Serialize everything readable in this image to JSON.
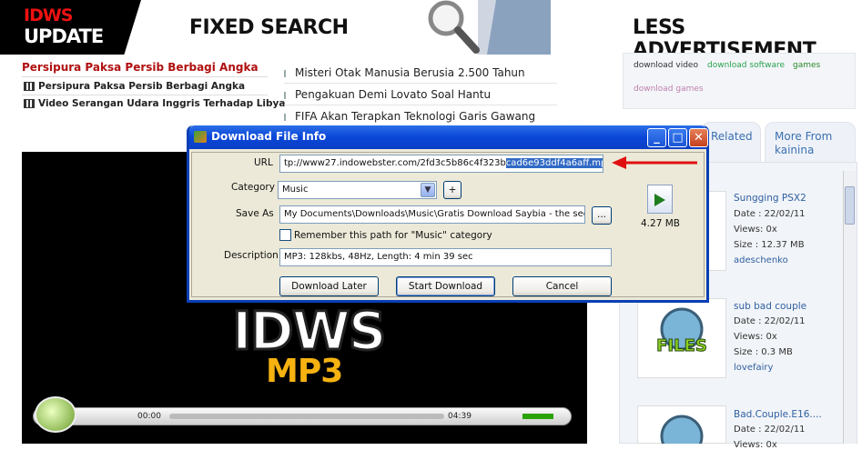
{
  "banner": {
    "logo_top": "IDWS",
    "logo_bottom": "UPDATE",
    "fixed_search": "FIXED SEARCH",
    "less_ad": "LESS ADVERTISEMENT"
  },
  "featured": {
    "title": "Persipura Paksa Persib Berbagi Angka",
    "items": [
      "Persipura Paksa Persib Berbagi Angka",
      "Video Serangan Udara Inggris Terhadap Libya"
    ]
  },
  "news": [
    "Misteri Otak Manusia Berusia 2.500 Tahun",
    "Pengakuan Demi Lovato Soal Hantu",
    "FIFA Akan Terapkan Teknologi Garis Gawang"
  ],
  "tags": {
    "t1": "download video",
    "t2": "download software",
    "t3": "games",
    "t4": "download games"
  },
  "tabs": {
    "related": "Related",
    "more_from_1": "More From",
    "more_from_2": "kainina"
  },
  "player": {
    "logo": "IDWS",
    "sub": "MP3",
    "time_elapsed": "00:00",
    "time_total": "04:39"
  },
  "sidebar_items": [
    {
      "title": "Sungging PSX2",
      "date": "Date : 22/02/11",
      "views": "Views: 0x",
      "size": "Size : 12.37 MB",
      "user": "adeschenko"
    },
    {
      "title": "sub bad couple",
      "date": "Date : 22/02/11",
      "views": "Views: 0x",
      "size": "Size : 0.3 MB",
      "user": "lovefairy"
    },
    {
      "title": "Bad.Couple.E16....",
      "date": "Date : 22/02/11",
      "views": "Views: 0x"
    }
  ],
  "dialog": {
    "title": "Download File Info",
    "url_label": "URL",
    "url_plain": "tp://www27.indowebster.com/2fd3c5b86c4f323b",
    "url_selected": "cad6e93ddf4a6aff.mp3",
    "category_label": "Category",
    "category_value": "Music",
    "plus": "+",
    "saveas_label": "Save As",
    "saveas_value": "My Documents\\Downloads\\Music\\Gratis Download Saybia - the secor",
    "browse": "...",
    "remember": "Remember this path for \"Music\" category",
    "description_label": "Description",
    "description_value": "MP3: 128kbs, 48Hz, Length: 4 min 39 sec",
    "file_size": "4.27  MB",
    "btn_later": "Download Later",
    "btn_start": "Start Download",
    "btn_cancel": "Cancel"
  },
  "colors": {
    "xp_title_blue": "#0a46d8",
    "dialog_bg": "#ece9d8",
    "accent_red": "#b01010",
    "link_blue": "#3060a0",
    "selection": "#316ac5"
  }
}
